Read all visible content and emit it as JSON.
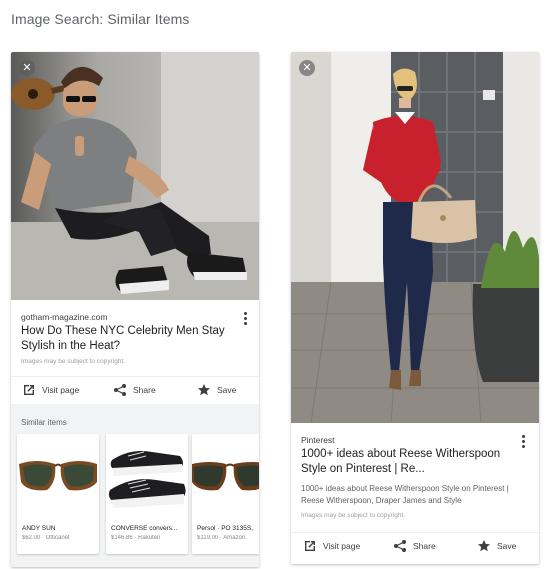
{
  "page": {
    "title": "Image Search: Similar Items"
  },
  "left_card": {
    "source": "gotham-magazine.com",
    "headline": "How Do These NYC Celebrity Men Stay Stylish in the Heat?",
    "copyright": "Images may be subject to copyright.",
    "actions": {
      "visit": "Visit page",
      "share": "Share",
      "save": "Save"
    },
    "similar": {
      "heading": "Similar items",
      "items": [
        {
          "name": "ANDY SUN",
          "price": "$62.00 · Otticanet"
        },
        {
          "name": "CONVERSE convers...",
          "price": "$146.86 · Rakuten"
        },
        {
          "name": "Persol · PO 3135S,",
          "price": "$119.00 · Amazon."
        }
      ]
    }
  },
  "right_card": {
    "source": "Pinterest",
    "headline": "1000+ ideas about Reese Witherspoon Style on Pinterest | Re...",
    "description": "1000+ ideas about Reese Witherspoon Style on Pinterest | Reese Witherspoon, Draper James and Style",
    "copyright": "Images may be subject to copyright.",
    "actions": {
      "visit": "Visit page",
      "share": "Share",
      "save": "Save"
    }
  },
  "icons": {
    "close": "close-icon",
    "more": "more-vert-icon",
    "visit": "open-in-new-icon",
    "share": "share-icon",
    "save": "star-icon"
  }
}
